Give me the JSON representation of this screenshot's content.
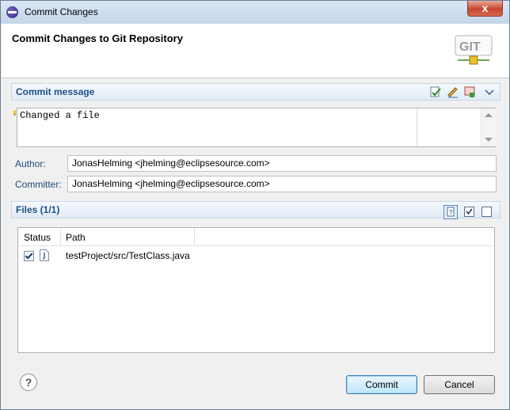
{
  "window": {
    "title": "Commit Changes",
    "close_label": "x"
  },
  "header": {
    "heading": "Commit Changes to Git Repository",
    "logo_text": "GIT"
  },
  "commit_message": {
    "section_title": "Commit message",
    "text": "Changed a file"
  },
  "author": {
    "label": "Author:",
    "value": "JonasHelming <jhelming@eclipsesource.com>"
  },
  "committer": {
    "label": "Committer:",
    "value": "JonasHelming <jhelming@eclipsesource.com>"
  },
  "files": {
    "section_title": "Files (1/1)",
    "columns": [
      "Status",
      "Path"
    ],
    "rows": [
      {
        "checked": true,
        "path": "testProject/src/TestClass.java"
      }
    ]
  },
  "buttons": {
    "commit": "Commit",
    "cancel": "Cancel",
    "help": "?"
  }
}
